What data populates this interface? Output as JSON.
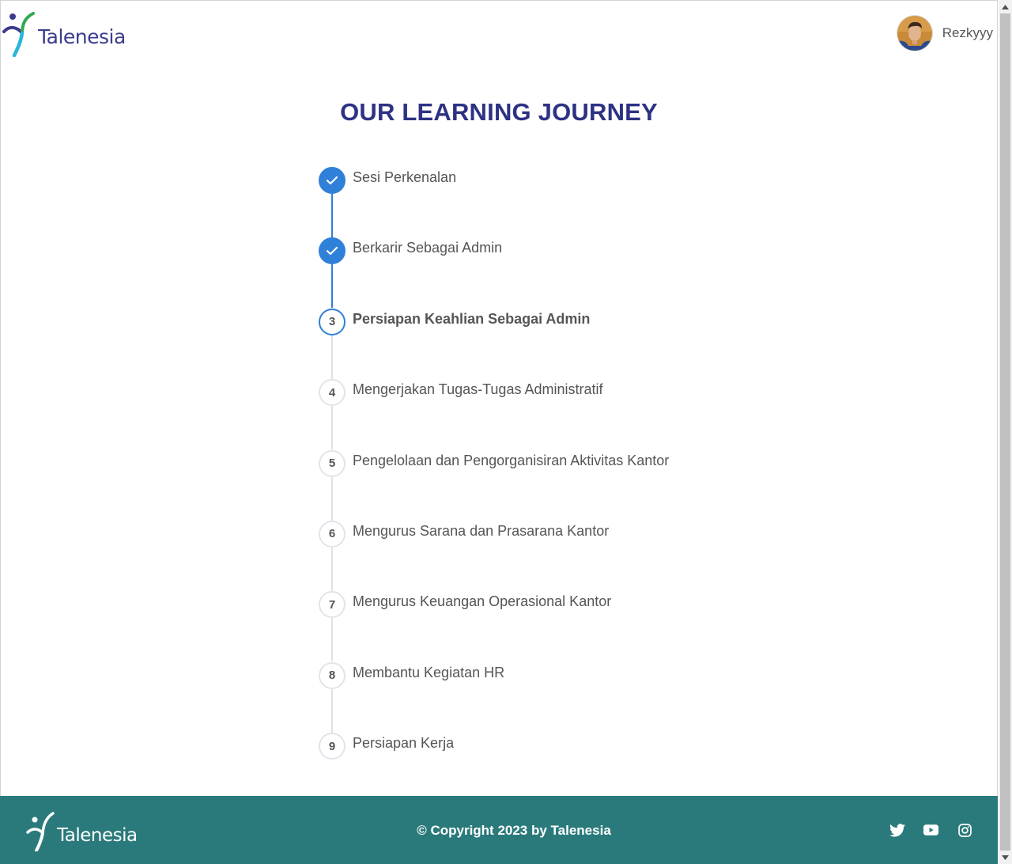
{
  "header": {
    "logo_text": "Talenesia",
    "user_name": "Rezkyyy"
  },
  "main": {
    "title": "OUR LEARNING JOURNEY",
    "steps": [
      {
        "number": "1",
        "label": "Sesi Perkenalan",
        "status": "completed"
      },
      {
        "number": "2",
        "label": "Berkarir Sebagai Admin",
        "status": "completed"
      },
      {
        "number": "3",
        "label": "Persiapan Keahlian Sebagai Admin",
        "status": "active"
      },
      {
        "number": "4",
        "label": "Mengerjakan Tugas-Tugas Administratif",
        "status": "pending"
      },
      {
        "number": "5",
        "label": "Pengelolaan dan Pengorganisiran Aktivitas Kantor",
        "status": "pending"
      },
      {
        "number": "6",
        "label": "Mengurus Sarana dan Prasarana Kantor",
        "status": "pending"
      },
      {
        "number": "7",
        "label": "Mengurus Keuangan Operasional Kantor",
        "status": "pending"
      },
      {
        "number": "8",
        "label": "Membantu Kegiatan HR",
        "status": "pending"
      },
      {
        "number": "9",
        "label": "Persiapan Kerja",
        "status": "pending"
      }
    ]
  },
  "footer": {
    "logo_text": "Talenesia",
    "copyright": "© Copyright 2023 by Talenesia",
    "socials": [
      "twitter-icon",
      "youtube-icon",
      "instagram-icon"
    ]
  },
  "colors": {
    "title": "#2d3283",
    "accent": "#2f80d8",
    "footer_bg": "#2b7a7b",
    "text": "#555555"
  }
}
